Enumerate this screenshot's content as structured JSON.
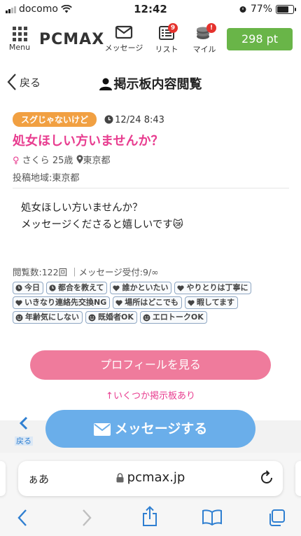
{
  "status_bar": {
    "carrier": "docomo",
    "time": "12:42",
    "battery": "77%"
  },
  "app_nav": {
    "menu_label": "Menu",
    "logo": "PCMAX",
    "message_label": "メッセージ",
    "list_label": "リスト",
    "list_badge": "9",
    "mile_label": "マイル",
    "mile_badge": "!",
    "points": "298 pt"
  },
  "page_header": {
    "back_label": "戻る",
    "title": "掲示板内容閲覧"
  },
  "post": {
    "tag": "スグじゃないけど",
    "date": "12/24 8:43",
    "title": "処女ほしい方いませんか？",
    "gender_symbol": "♀",
    "name": "さくら",
    "age": "25歳",
    "location": "東京都",
    "region_line": "投稿地域:東京都",
    "body_line1": "処女ほしい方いませんか？",
    "body_line2": "メッセージくださると嬉しいです😿",
    "stats": "閲覧数:122回 ｜メッセージ受付:9/∞",
    "chips": [
      {
        "icon": "clock-icon",
        "label": "今日"
      },
      {
        "icon": "clock-icon",
        "label": "都合を教えて"
      },
      {
        "icon": "heart-icon",
        "label": "誰かといたい"
      },
      {
        "icon": "heart-icon",
        "label": "やりとりは丁寧に"
      },
      {
        "icon": "heart-icon",
        "label": "いきなり連絡先交換NG"
      },
      {
        "icon": "heart-icon",
        "label": "場所はどこでも"
      },
      {
        "icon": "heart-icon",
        "label": "暇してます"
      },
      {
        "icon": "smile-icon",
        "label": "年齢気にしない"
      },
      {
        "icon": "smile-icon",
        "label": "既婚者OK"
      },
      {
        "icon": "smile-icon",
        "label": "エロトークOK"
      }
    ]
  },
  "actions": {
    "profile_button": "プロフィールを見る",
    "more_posts": "↑いくつか掲示板あり",
    "bottom_back_label": "戻る",
    "message_button": "メッセージする"
  },
  "browser": {
    "aa": "ぁあ",
    "url": "pcmax.jp"
  },
  "colors": {
    "accent_pink": "#e83c8f",
    "points_green": "#69b548",
    "tag_orange": "#f1a042",
    "message_blue": "#6aaeea",
    "profile_pink": "#ef7b9c"
  }
}
